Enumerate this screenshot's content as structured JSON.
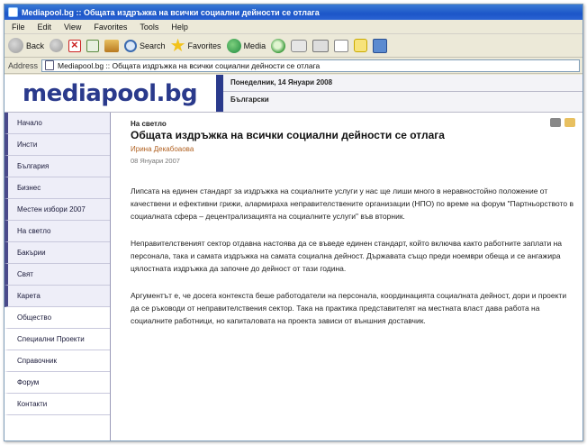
{
  "window": {
    "title": "Mediapool.bg :: Общата издръжка на всички социални дейности се отлага"
  },
  "menu": [
    "File",
    "Edit",
    "View",
    "Favorites",
    "Tools",
    "Help"
  ],
  "toolbar": {
    "back": "Back",
    "search": "Search",
    "favorites": "Favorites",
    "media": "Media"
  },
  "address": {
    "label": "Address",
    "value": "Mediapool.bg :: Общата издръжка на всички социални дейности се отлага"
  },
  "site": {
    "logo": "mediapool.bg",
    "header_date": "Понеделник, 14 Януари 2008",
    "header_sub": "Български"
  },
  "sidebar": {
    "items": [
      "Начало",
      "Инсти",
      "България",
      "Бизнес",
      "Местен избори 2007",
      "На светло",
      "Бакърии",
      "Свят",
      "Карета",
      "Общество",
      "Специални Проекти",
      "Справочник",
      "Форум",
      "Контакти"
    ]
  },
  "article": {
    "kicker": "На светло",
    "headline": "Общата издръжка на всички социални дейности се отлага",
    "author": "Ирина Декабоаова",
    "date": "08 Януари 2007",
    "paragraphs": [
      "Липсата на единен стандарт за издръжка на социалните услуги у нас ще лиши много в неравностойно положение от качествени и ефективни грижи, алармираха неправителствените организации (НПО) по време на форум \"Партньорството в социалната сфера – децентрализацията на социалните услуги\" във вторник.",
      "Неправителственият сектор отдавна настоява да се въведе единен стандарт, който включва както работните заплати на персонала, така и самата издръжка на самата социална дейност. Държавата също преди ноември обеща и се ангажира цялостната издръжка да започне до дейност от тази година.",
      "Аргументът е, че досега контекста беше работодатели на персонала, координацията социалната дейност, дори и проекти да се ръководи от неправителствения сектор. Така на практика представителят на местната власт дава работа на социалните работници, но капиталовата на проекта зависи от външния доставчик."
    ]
  },
  "colors": {
    "titlebar": "#1c56c8",
    "logo": "#2a3a8c",
    "sidebar_accent": "#4a4a8a",
    "author": "#b06020"
  }
}
